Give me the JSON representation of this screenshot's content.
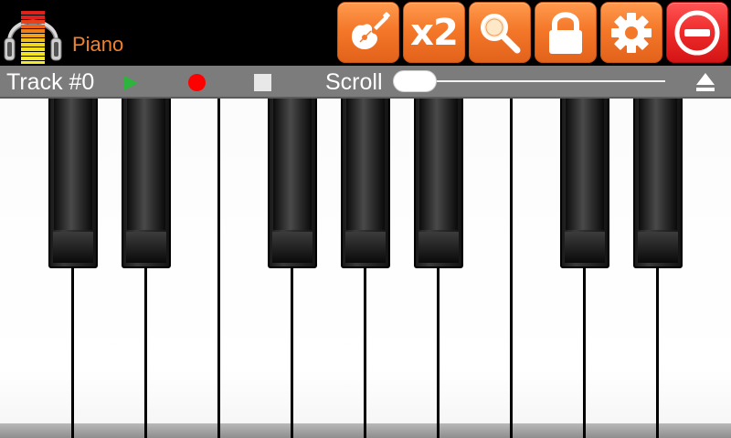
{
  "app": {
    "title": "Piano",
    "logo_icon": "headphones-level-meter-icon"
  },
  "toolbar": {
    "accent_color": "#f47a2a",
    "danger_color": "#ee2a2a",
    "buttons": [
      {
        "name": "instrument-button",
        "icon": "guitar-icon"
      },
      {
        "name": "zoom-button",
        "icon": "x2-text",
        "label": "x2"
      },
      {
        "name": "search-button",
        "icon": "magnifier-icon"
      },
      {
        "name": "lock-button",
        "icon": "lock-icon"
      },
      {
        "name": "settings-button",
        "icon": "gear-icon"
      },
      {
        "name": "exit-button",
        "icon": "no-entry-icon"
      }
    ]
  },
  "transport": {
    "track_label": "Track #0",
    "play_icon": "play-icon",
    "record_icon": "record-icon",
    "stop_icon": "stop-icon",
    "scroll_label": "Scroll",
    "scroll_position": 0,
    "eject_icon": "eject-icon",
    "play_color": "#2db43c",
    "record_color": "#ff0000"
  },
  "keyboard": {
    "white_keys": 10,
    "black_key_after_white": [
      0,
      1,
      3,
      4,
      5,
      7,
      8
    ]
  }
}
